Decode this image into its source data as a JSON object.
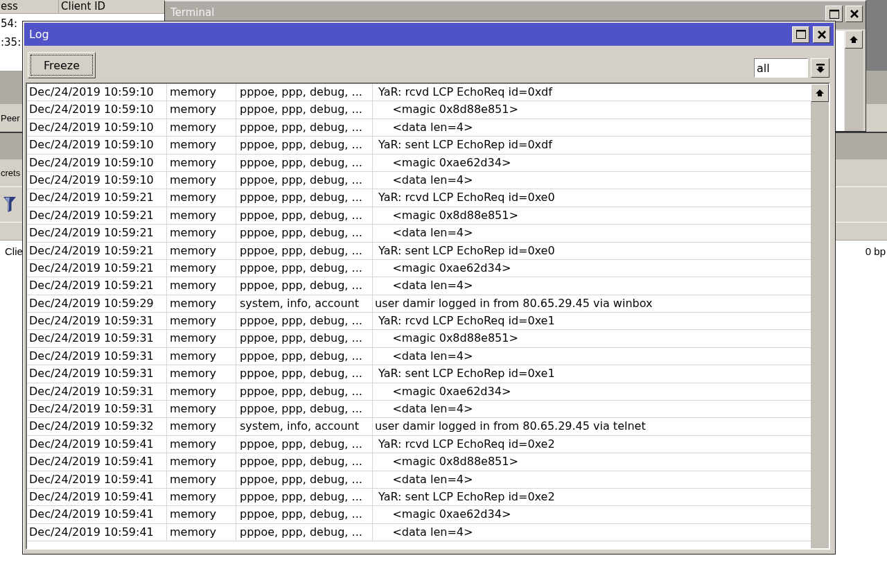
{
  "desktop_windows": {
    "table_window": {
      "columns": [
        "ess",
        "Client ID"
      ],
      "rows": [
        "54:",
        ":35:"
      ]
    },
    "middle_window": {
      "label": "Peer"
    },
    "main_window": {
      "tab_label": "crets",
      "row_cells": [
        "Clie",
        "0 bp"
      ]
    },
    "terminal": {
      "title": "Terminal"
    }
  },
  "log_window": {
    "title": "Log",
    "freeze_button": "Freeze",
    "topic_filter": {
      "value": "all"
    },
    "rows": [
      {
        "cells": [
          "Dec/24/2019 10:59:10",
          "memory",
          "pppoe, ppp, debug, ...",
          " YaR: rcvd LCP EchoReq id=0xdf"
        ]
      },
      {
        "cells": [
          "Dec/24/2019 10:59:10",
          "memory",
          "pppoe, ppp, debug, ...",
          "     <magic 0x8d88e851>"
        ]
      },
      {
        "cells": [
          "Dec/24/2019 10:59:10",
          "memory",
          "pppoe, ppp, debug, ...",
          "     <data len=4>"
        ]
      },
      {
        "cells": [
          "Dec/24/2019 10:59:10",
          "memory",
          "pppoe, ppp, debug, ...",
          " YaR: sent LCP EchoRep id=0xdf"
        ]
      },
      {
        "cells": [
          "Dec/24/2019 10:59:10",
          "memory",
          "pppoe, ppp, debug, ...",
          "     <magic 0xae62d34>"
        ]
      },
      {
        "cells": [
          "Dec/24/2019 10:59:10",
          "memory",
          "pppoe, ppp, debug, ...",
          "     <data len=4>"
        ]
      },
      {
        "cells": [
          "Dec/24/2019 10:59:21",
          "memory",
          "pppoe, ppp, debug, ...",
          " YaR: rcvd LCP EchoReq id=0xe0"
        ]
      },
      {
        "cells": [
          "Dec/24/2019 10:59:21",
          "memory",
          "pppoe, ppp, debug, ...",
          "     <magic 0x8d88e851>"
        ]
      },
      {
        "cells": [
          "Dec/24/2019 10:59:21",
          "memory",
          "pppoe, ppp, debug, ...",
          "     <data len=4>"
        ]
      },
      {
        "cells": [
          "Dec/24/2019 10:59:21",
          "memory",
          "pppoe, ppp, debug, ...",
          " YaR: sent LCP EchoRep id=0xe0"
        ]
      },
      {
        "cells": [
          "Dec/24/2019 10:59:21",
          "memory",
          "pppoe, ppp, debug, ...",
          "     <magic 0xae62d34>"
        ]
      },
      {
        "cells": [
          "Dec/24/2019 10:59:21",
          "memory",
          "pppoe, ppp, debug, ...",
          "     <data len=4>"
        ]
      },
      {
        "cells": [
          "Dec/24/2019 10:59:29",
          "memory",
          "system, info, account",
          "user damir logged in from 80.65.29.45 via winbox"
        ]
      },
      {
        "cells": [
          "Dec/24/2019 10:59:31",
          "memory",
          "pppoe, ppp, debug, ...",
          " YaR: rcvd LCP EchoReq id=0xe1"
        ]
      },
      {
        "cells": [
          "Dec/24/2019 10:59:31",
          "memory",
          "pppoe, ppp, debug, ...",
          "     <magic 0x8d88e851>"
        ]
      },
      {
        "cells": [
          "Dec/24/2019 10:59:31",
          "memory",
          "pppoe, ppp, debug, ...",
          "     <data len=4>"
        ]
      },
      {
        "cells": [
          "Dec/24/2019 10:59:31",
          "memory",
          "pppoe, ppp, debug, ...",
          " YaR: sent LCP EchoRep id=0xe1"
        ]
      },
      {
        "cells": [
          "Dec/24/2019 10:59:31",
          "memory",
          "pppoe, ppp, debug, ...",
          "     <magic 0xae62d34>"
        ]
      },
      {
        "cells": [
          "Dec/24/2019 10:59:31",
          "memory",
          "pppoe, ppp, debug, ...",
          "     <data len=4>"
        ]
      },
      {
        "cells": [
          "Dec/24/2019 10:59:32",
          "memory",
          "system, info, account",
          "user damir logged in from 80.65.29.45 via telnet"
        ]
      },
      {
        "cells": [
          "Dec/24/2019 10:59:41",
          "memory",
          "pppoe, ppp, debug, ...",
          " YaR: rcvd LCP EchoReq id=0xe2"
        ]
      },
      {
        "cells": [
          "Dec/24/2019 10:59:41",
          "memory",
          "pppoe, ppp, debug, ...",
          "     <magic 0x8d88e851>"
        ]
      },
      {
        "cells": [
          "Dec/24/2019 10:59:41",
          "memory",
          "pppoe, ppp, debug, ...",
          "     <data len=4>"
        ]
      },
      {
        "cells": [
          "Dec/24/2019 10:59:41",
          "memory",
          "pppoe, ppp, debug, ...",
          " YaR: sent LCP EchoRep id=0xe2"
        ]
      },
      {
        "cells": [
          "Dec/24/2019 10:59:41",
          "memory",
          "pppoe, ppp, debug, ...",
          "     <magic 0xae62d34>"
        ]
      },
      {
        "cells": [
          "Dec/24/2019 10:59:41",
          "memory",
          "pppoe, ppp, debug, ...",
          "     <data len=4>"
        ]
      }
    ]
  }
}
